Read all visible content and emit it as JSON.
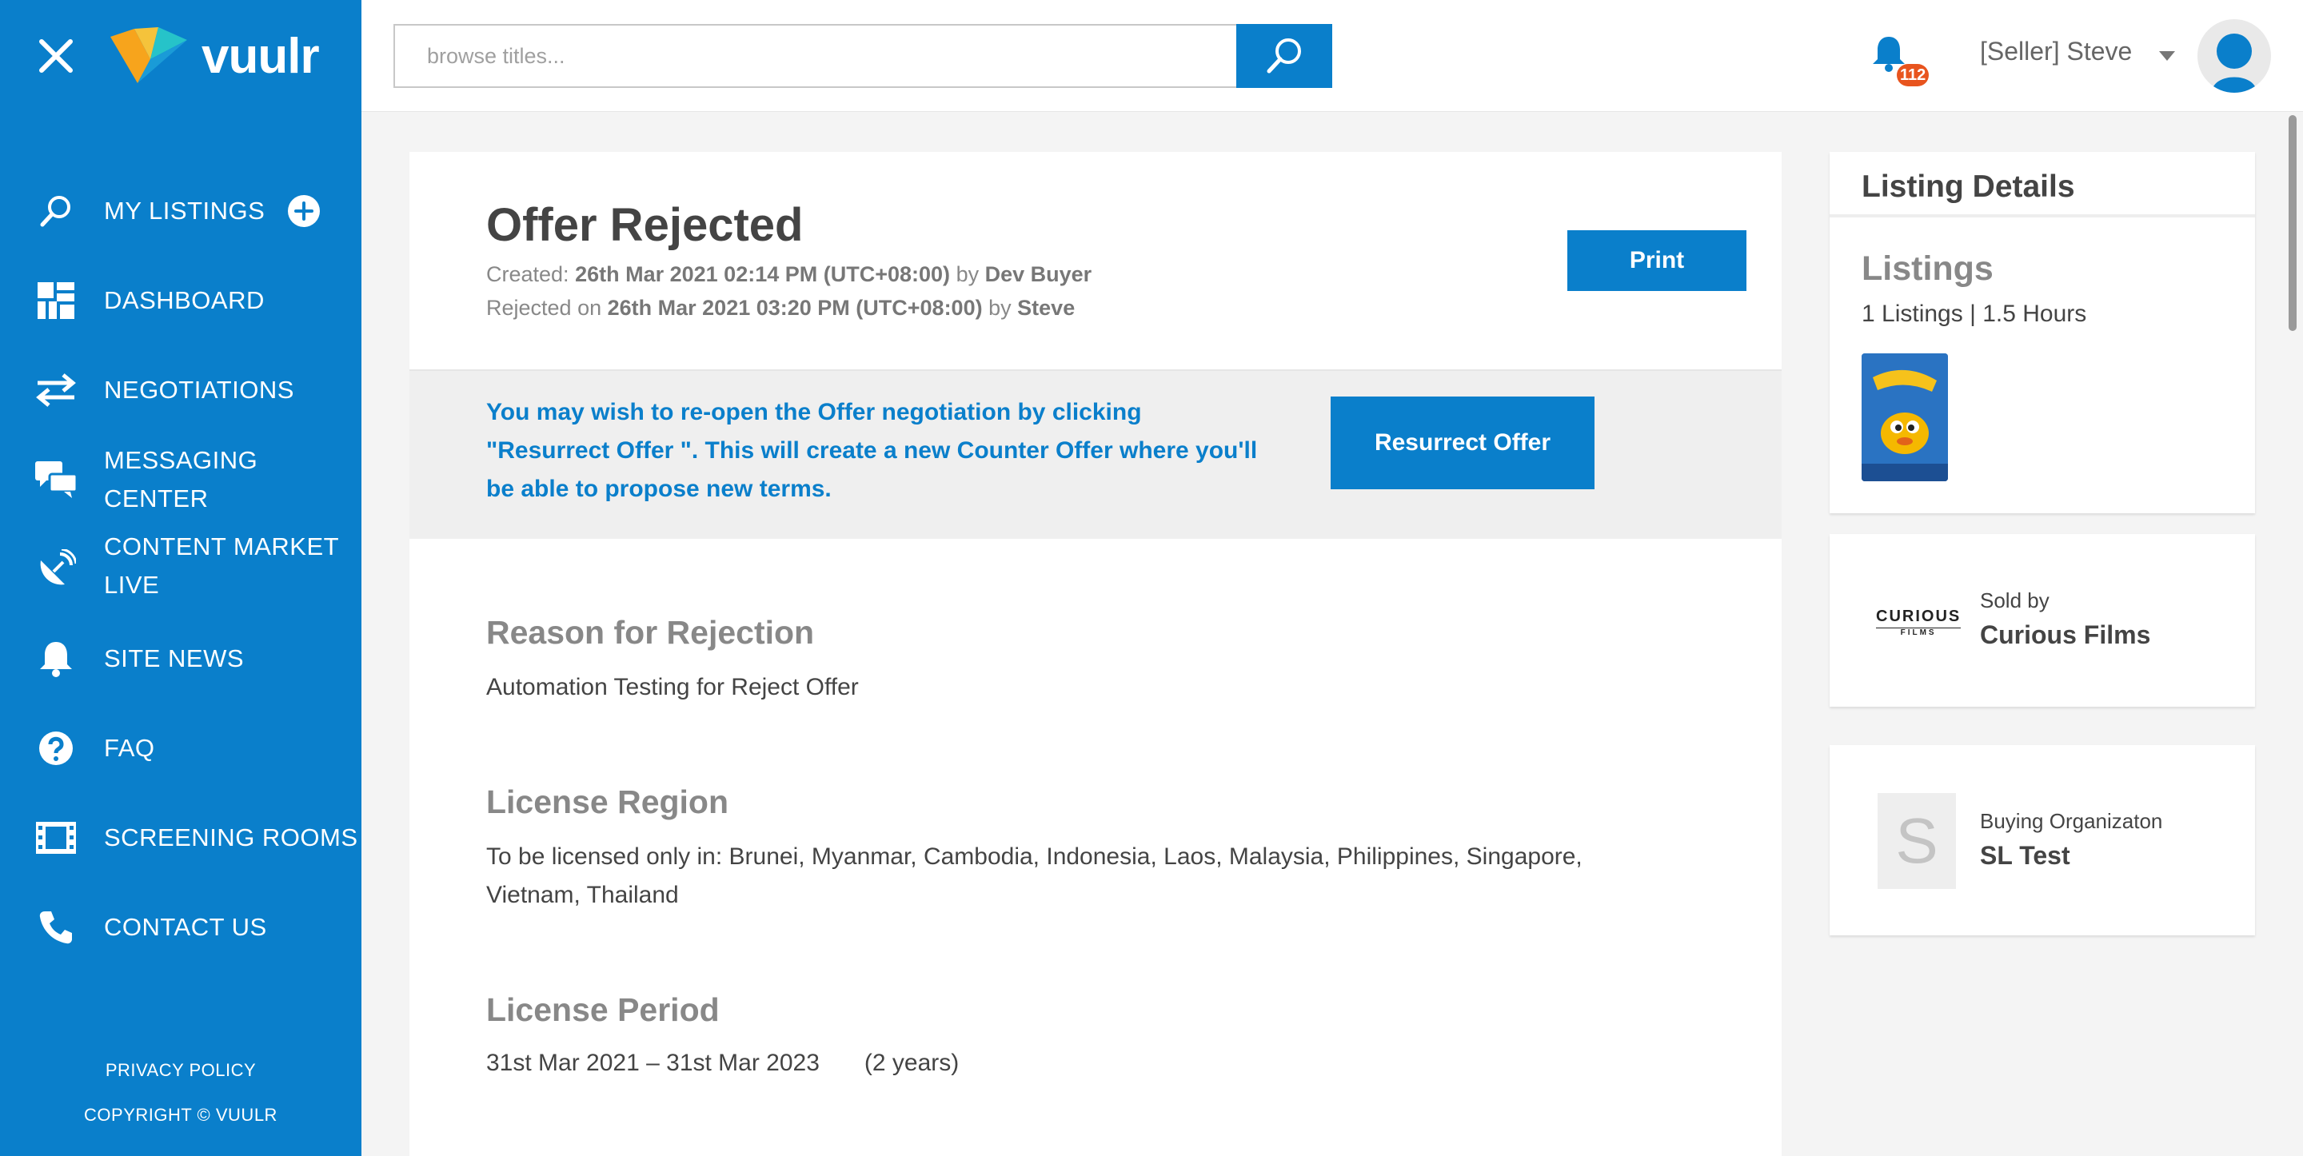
{
  "sidebar": {
    "logo_text": "vuulr",
    "items": [
      {
        "label": "MY LISTINGS",
        "icon": "search-icon"
      },
      {
        "label": "DASHBOARD",
        "icon": "dashboard-icon"
      },
      {
        "label": "NEGOTIATIONS",
        "icon": "swap-arrows-icon"
      },
      {
        "label": "MESSAGING CENTER",
        "icon": "chat-bubbles-icon"
      },
      {
        "label": "CONTENT MARKET",
        "label2": "LIVE",
        "icon": "satellite-dish-icon"
      },
      {
        "label": "SITE NEWS",
        "icon": "bell-icon"
      },
      {
        "label": "FAQ",
        "icon": "question-icon"
      },
      {
        "label": "SCREENING ROOMS",
        "icon": "film-icon"
      },
      {
        "label": "CONTACT US",
        "icon": "phone-icon"
      }
    ],
    "footer_privacy": "PRIVACY POLICY",
    "footer_copyright": "COPYRIGHT © VUULR"
  },
  "topbar": {
    "search_placeholder": "browse titles...",
    "notification_count": "112",
    "user_name": "[Seller] Steve"
  },
  "offer": {
    "title": "Offer Rejected",
    "created_label": "Created:",
    "created_date": "26th Mar 2021 02:14 PM (UTC+08:00)",
    "created_by_label": "by",
    "created_by": "Dev Buyer",
    "rejected_label": "Rejected on",
    "rejected_date": "26th Mar 2021 03:20 PM (UTC+08:00)",
    "rejected_by_label": "by",
    "rejected_by": "Steve",
    "print_label": "Print",
    "banner_text": "You may wish to re-open the Offer negotiation by clicking \"Resurrect Offer \". This will create a new Counter Offer where you'll be able to propose new terms.",
    "resurrect_label": "Resurrect Offer",
    "reason_title": "Reason for Rejection",
    "reason_text": "Automation Testing for Reject Offer",
    "region_title": "License Region",
    "region_text": "To be licensed only in: Brunei, Myanmar, Cambodia, Indonesia, Laos, Malaysia, Philippines, Singapore, Vietnam, Thailand",
    "period_title": "License Period",
    "period_range": "31st Mar 2021 – 31st Mar 2023",
    "period_duration": "(2 years)"
  },
  "listing_details": {
    "title": "Listing Details",
    "listings_heading": "Listings",
    "listings_summary": "1 Listings | 1.5 Hours",
    "sold_by_label": "Sold by",
    "seller": "Curious Films",
    "seller_logo_text": "CURIOUS",
    "seller_logo_sub": "FILMS",
    "buying_org_label": "Buying Organizaton",
    "buying_org": "SL Test",
    "buying_org_initial": "S"
  },
  "colors": {
    "brand_blue": "#0a7fcb",
    "badge_orange": "#e8541e"
  }
}
